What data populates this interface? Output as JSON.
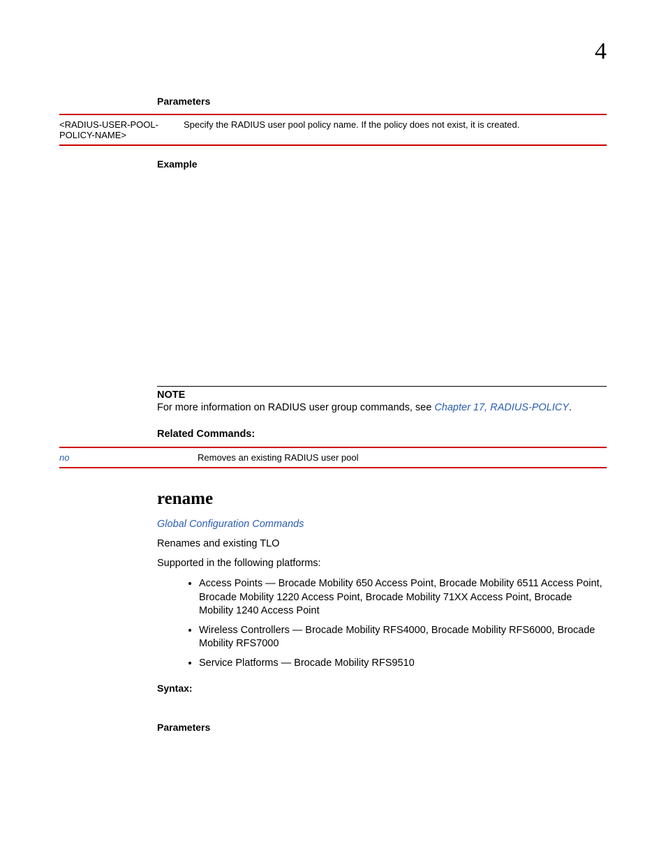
{
  "chapterNumber": "4",
  "sections": {
    "parameters1": {
      "heading": "Parameters",
      "row": {
        "key": "<RADIUS-USER-POOL-POLICY-NAME>",
        "desc": "Specify the RADIUS user pool policy name. If the policy does not exist, it is created."
      }
    },
    "exampleHeading": "Example",
    "note": {
      "label": "NOTE",
      "textBefore": "For more information on RADIUS user group commands, see ",
      "link": "Chapter 17, RADIUS-POLICY",
      "textAfter": "."
    },
    "related": {
      "heading": "Related Commands:",
      "row": {
        "key": "no",
        "desc": "Removes an existing RADIUS user pool"
      }
    },
    "rename": {
      "title": "rename",
      "subtitle": "Global Configuration Commands",
      "desc": "Renames and existing TLO",
      "supported": "Supported in the following platforms:",
      "bullets": [
        "Access Points — Brocade Mobility 650 Access Point, Brocade Mobility 6511 Access Point, Brocade Mobility 1220 Access Point, Brocade Mobility 71XX Access Point, Brocade Mobility 1240 Access Point",
        "Wireless Controllers — Brocade Mobility RFS4000, Brocade Mobility RFS6000, Brocade Mobility RFS7000",
        "Service Platforms — Brocade Mobility RFS9510"
      ],
      "syntaxHeading": "Syntax:",
      "parameters2Heading": "Parameters"
    }
  }
}
